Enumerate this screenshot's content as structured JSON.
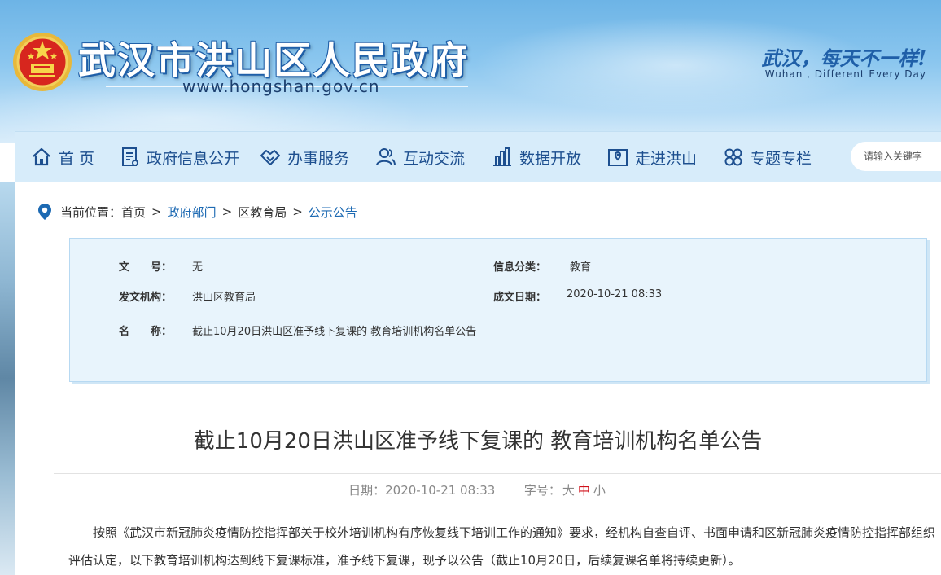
{
  "header": {
    "site_title": "武汉市洪山区人民政府",
    "site_url": "www.hongshan.gov.cn",
    "slogan": "武汉，每天不一样!",
    "slogan_en": "Wuhan , Different Every Day"
  },
  "nav": {
    "items": [
      {
        "label": "首 页",
        "icon": "home-icon"
      },
      {
        "label": "政府信息公开",
        "icon": "document-icon"
      },
      {
        "label": "办事服务",
        "icon": "handshake-icon"
      },
      {
        "label": "互动交流",
        "icon": "users-icon"
      },
      {
        "label": "数据开放",
        "icon": "bar-chart-icon"
      },
      {
        "label": "走进洪山",
        "icon": "map-icon"
      },
      {
        "label": "专题专栏",
        "icon": "grid-icon"
      }
    ],
    "search_placeholder": "请输入关键字"
  },
  "breadcrumb": {
    "prefix": "当前位置：",
    "items": [
      "首页",
      "政府部门",
      "区教育局",
      "公示公告"
    ],
    "separator": ">"
  },
  "meta": {
    "doc_no_label": "文　　号：",
    "doc_no_value": "无",
    "category_label": "信息分类：",
    "category_value": "教育",
    "issuer_label": "发文机构：",
    "issuer_value": "洪山区教育局",
    "date_label": "成文日期：",
    "date_value": "2020-10-21 08:33",
    "name_label": "名　　称：",
    "name_value": "截止10月20日洪山区准予线下复课的 教育培训机构名单公告"
  },
  "article": {
    "title": "截止10月20日洪山区准予线下复课的 教育培训机构名单公告",
    "date_label": "日期：",
    "date_value": "2020-10-21 08:33",
    "font_label": "字号：",
    "font_sizes": [
      "大",
      "中",
      "小"
    ],
    "body": "按照《武汉市新冠肺炎疫情防控指挥部关于校外培训机构有序恢复线下培训工作的通知》要求，经机构自查自评、书面申请和区新冠肺炎疫情防控指挥部组织评估认定，以下教育培训机构达到线下复课标准，准予线下复课，现予以公告（截止10月20日，后续复课名单将持续更新）。"
  },
  "colors": {
    "nav_text": "#1d4f8f",
    "link": "#1d6ab3",
    "active_font_size": "#d0121b"
  }
}
